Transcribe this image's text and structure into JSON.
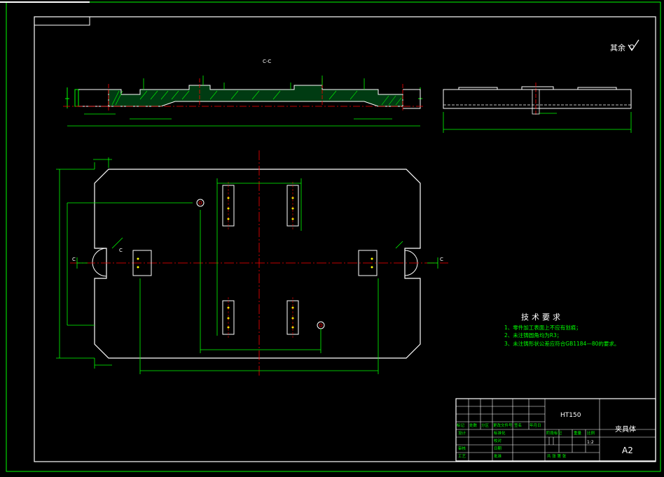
{
  "colors": {
    "background": "#000000",
    "outline": "#ffffff",
    "dimension": "#00ff00",
    "centerline": "#ff0000",
    "hatch": "#00ff00",
    "text": "#ffffff",
    "tech_heading": "#ffffff",
    "tech_item": "#00ff00",
    "holes": "#ffff00"
  },
  "section_label": "C-C",
  "surface_note": "其余",
  "section_marks": {
    "left": "C",
    "right": "C",
    "top": "C"
  },
  "tech_requirements": {
    "heading": "技术要求",
    "items": [
      "1、零件加工表面上不应有划痕；",
      "2、未注铸圆角均为R3；",
      "3、未注铸形状公差应符合GB1184—80的要求。"
    ]
  },
  "title_block": {
    "material": "HT150",
    "part_name": "夹具体",
    "sheet_size": "A2",
    "scale": "1:2",
    "header_cells": [
      "标记",
      "处数",
      "分区",
      "更改文件号",
      "签名",
      "年月日"
    ],
    "row_labels": [
      "设计",
      "标准化",
      "审核",
      "工艺",
      "批准",
      "校对",
      "日期"
    ],
    "stage_labels": [
      "阶段标记",
      "重量",
      "比例"
    ],
    "total_sheets": "共 张 第 张"
  }
}
